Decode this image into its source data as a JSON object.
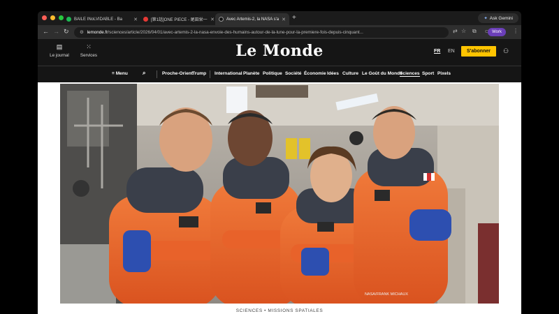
{
  "browser": {
    "tabs": [
      {
        "title": "BAILE INoLVIDABLE - Ba",
        "favicon_color": "#1db954"
      },
      {
        "title": "[第1話]ONE PIECE - 尾田栄一",
        "favicon_color": "#e53935"
      },
      {
        "title": "Avec Artemis-2, la NASA s'a",
        "favicon_color": "#222222"
      }
    ],
    "new_tab": "+",
    "gemini_label": "Ask Gemini",
    "url_host": "lemonde.fr",
    "url_path": "/sciences/article/2026/04/01/avec-artemis-2-la-nasa-envoie-des-humains-autour-de-la-lune-pour-la-premiere-fois-depuis-cinquant...",
    "profile_label": "Work"
  },
  "header": {
    "journal_label": "Le journal",
    "services_label": "Services",
    "logo": "Le Monde",
    "lang_fr": "FR",
    "lang_en": "EN",
    "subscribe_label": "S'abonner"
  },
  "nav": {
    "menu_label": "Menu",
    "items": [
      "Proche-Orient",
      "Trump",
      "International",
      "Planète",
      "Politique",
      "Société",
      "Économie",
      "Idées",
      "Culture",
      "Le Goût du Monde",
      "Sciences",
      "Sport",
      "Pixels"
    ]
  },
  "article": {
    "photo_credit": "NASA/FRANK MICHAUX",
    "caption": "SCIENCES • MISSIONS SPATIALES"
  },
  "colors": {
    "subscribe_bg": "#ffc400",
    "header_bg": "#151515",
    "suit_orange": "#e8622a"
  }
}
